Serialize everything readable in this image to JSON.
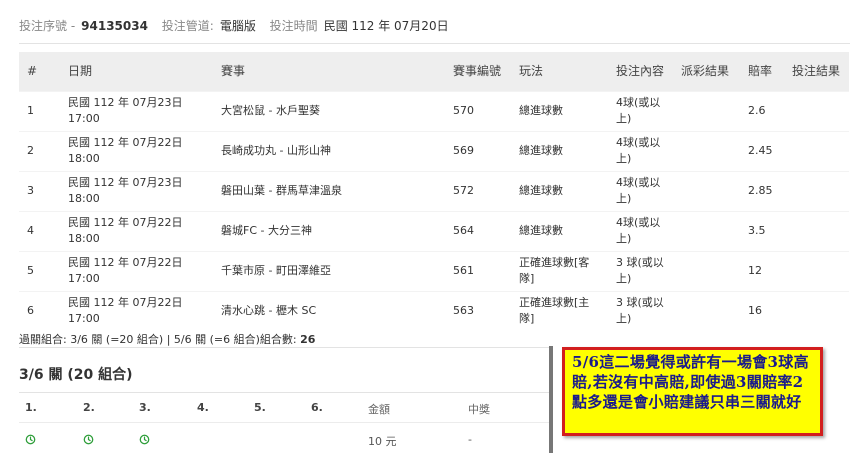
{
  "header": {
    "serial_label": "投注序號 -",
    "serial_value": "94135034",
    "channel_label": "投注管道:",
    "channel_value": "電腦版",
    "time_label": "投注時間",
    "time_value": "民國 112 年 07月20日"
  },
  "bets_table": {
    "columns": [
      "#",
      "日期",
      "賽事",
      "賽事編號",
      "玩法",
      "投注內容",
      "派彩結果",
      "賠率",
      "投注結果"
    ],
    "rows": [
      {
        "no": "1",
        "date": "民國 112 年 07月23日",
        "time": "17:00",
        "match": "大宮松鼠 - 水戶聖葵",
        "code": "570",
        "play": "總進球數",
        "content": "4球(或以上)",
        "result": "",
        "odds": "2.6",
        "outcome": ""
      },
      {
        "no": "2",
        "date": "民國 112 年 07月22日",
        "time": "18:00",
        "match": "長崎成功丸 - 山形山神",
        "code": "569",
        "play": "總進球數",
        "content": "4球(或以上)",
        "result": "",
        "odds": "2.45",
        "outcome": ""
      },
      {
        "no": "3",
        "date": "民國 112 年 07月23日",
        "time": "18:00",
        "match": "磐田山葉 - 群馬草津溫泉",
        "code": "572",
        "play": "總進球數",
        "content": "4球(或以上)",
        "result": "",
        "odds": "2.85",
        "outcome": ""
      },
      {
        "no": "4",
        "date": "民國 112 年 07月22日",
        "time": "18:00",
        "match": "磐城FC - 大分三神",
        "code": "564",
        "play": "總進球數",
        "content": "4球(或以上)",
        "result": "",
        "odds": "3.5",
        "outcome": ""
      },
      {
        "no": "5",
        "date": "民國 112 年 07月22日",
        "time": "17:00",
        "match": "千葉市原 - 町田澤維亞",
        "code": "561",
        "play": "正確進球數[客隊]",
        "content": "3 球(或以上)",
        "result": "",
        "odds": "12",
        "outcome": ""
      },
      {
        "no": "6",
        "date": "民國 112 年 07月22日",
        "time": "17:00",
        "match": "清水心跳 - 櫪木 SC",
        "code": "563",
        "play": "正確進球數[主隊]",
        "content": "3 球(或以上)",
        "result": "",
        "odds": "16",
        "outcome": ""
      }
    ]
  },
  "combo": {
    "text": "過關組合: 3/6 關 (=20 組合) | 5/6 關 (=6 組合)組合數: ",
    "count": "26"
  },
  "pass_section": {
    "title": "3/6 關 (20 組合)",
    "headers": [
      "1.",
      "2.",
      "3.",
      "4.",
      "5.",
      "6.",
      "金額",
      "中獎"
    ],
    "first_row": {
      "amount": "10 元",
      "win": "-"
    }
  },
  "annotation": {
    "text": "5/6這二場覺得或許有一場會3球高賠,若沒有中高賠,即使過3關賠率2點多還是會小賠建議只串三關就好"
  },
  "colors": {
    "clock_icon": "#2e9e3a",
    "note_background": "#ffff00",
    "note_border": "#d21f1f",
    "note_text": "#1a1a8c"
  }
}
